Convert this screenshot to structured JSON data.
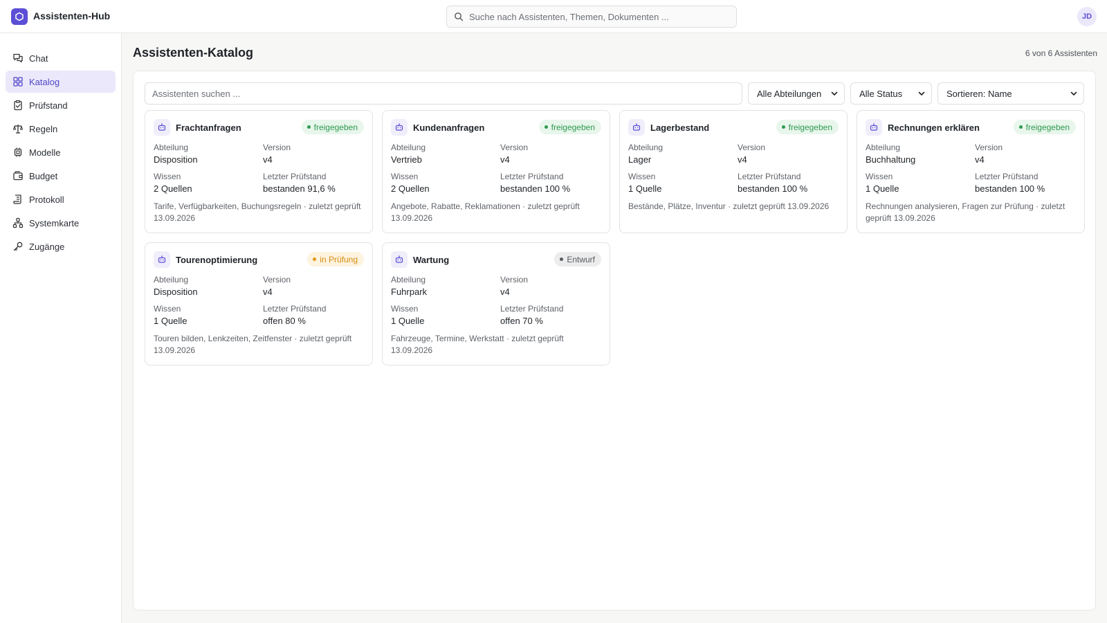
{
  "app": {
    "brand": "Assistenten-Hub",
    "user_initials": "JD"
  },
  "search": {
    "placeholder": "Suche nach Assistenten, Themen, Dokumenten ..."
  },
  "sidebar": {
    "items": [
      {
        "label": "Chat",
        "icon": "chat-icon"
      },
      {
        "label": "Katalog",
        "icon": "grid-icon",
        "active": true
      },
      {
        "label": "Prüfstand",
        "icon": "clipboard-check-icon"
      },
      {
        "label": "Regeln",
        "icon": "scale-icon"
      },
      {
        "label": "Modelle",
        "icon": "chip-icon"
      },
      {
        "label": "Budget",
        "icon": "wallet-icon"
      },
      {
        "label": "Protokoll",
        "icon": "scroll-icon"
      },
      {
        "label": "Systemkarte",
        "icon": "network-icon"
      },
      {
        "label": "Zugänge",
        "icon": "key-icon"
      }
    ]
  },
  "main": {
    "title": "Assistenten-Katalog",
    "count": "6 von 6 Assistenten",
    "filter": {
      "search_placeholder": "Assistenten suchen ...",
      "departments": "Alle Abteilungen",
      "status": "Alle Status",
      "sort": "Sortieren: Name"
    },
    "labels": {
      "department": "Abteilung",
      "version": "Version",
      "knowledge": "Wissen",
      "last_test": "Letzter Prüfstand"
    },
    "cards": [
      {
        "title": "Frachtanfragen",
        "status": "freigegeben",
        "status_type": "ok",
        "department": "Disposition",
        "version": "v4",
        "knowledge": "2 Quellen",
        "last_test": "bestanden 91,6 %",
        "description": "Tarife, Verfügbarkeiten, Buchungsregeln · zuletzt geprüft 13.09.2026"
      },
      {
        "title": "Kundenanfragen",
        "status": "freigegeben",
        "status_type": "ok",
        "department": "Vertrieb",
        "version": "v4",
        "knowledge": "2 Quellen",
        "last_test": "bestanden 100 %",
        "description": "Angebote, Rabatte, Reklamationen · zuletzt geprüft 13.09.2026"
      },
      {
        "title": "Lagerbestand",
        "status": "freigegeben",
        "status_type": "ok",
        "department": "Lager",
        "version": "v4",
        "knowledge": "1 Quelle",
        "last_test": "bestanden 100 %",
        "description": "Bestände, Plätze, Inventur · zuletzt geprüft 13.09.2026"
      },
      {
        "title": "Rechnungen erklären",
        "status": "freigegeben",
        "status_type": "ok",
        "department": "Buchhaltung",
        "version": "v4",
        "knowledge": "1 Quelle",
        "last_test": "bestanden 100 %",
        "description": "Rechnungen analysieren, Fragen zur Prüfung · zuletzt geprüft 13.09.2026"
      },
      {
        "title": "Tourenoptimierung",
        "status": "in Prüfung",
        "status_type": "wait",
        "department": "Disposition",
        "version": "v4",
        "knowledge": "1 Quelle",
        "last_test": "offen 80 %",
        "description": "Touren bilden, Lenkzeiten, Zeitfenster · zuletzt geprüft 13.09.2026"
      },
      {
        "title": "Wartung",
        "status": "Entwurf",
        "status_type": "draft",
        "department": "Fuhrpark",
        "version": "v4",
        "knowledge": "1 Quelle",
        "last_test": "offen 70 %",
        "description": "Fahrzeuge, Termine, Werkstatt · zuletzt geprüft 13.09.2026"
      }
    ]
  },
  "colors": {
    "accent": "#5b4fd6",
    "accent_bg": "#ebe8fb",
    "ok": "#2e9a4f",
    "wait": "#d58c0f",
    "draft": "#55595f"
  }
}
